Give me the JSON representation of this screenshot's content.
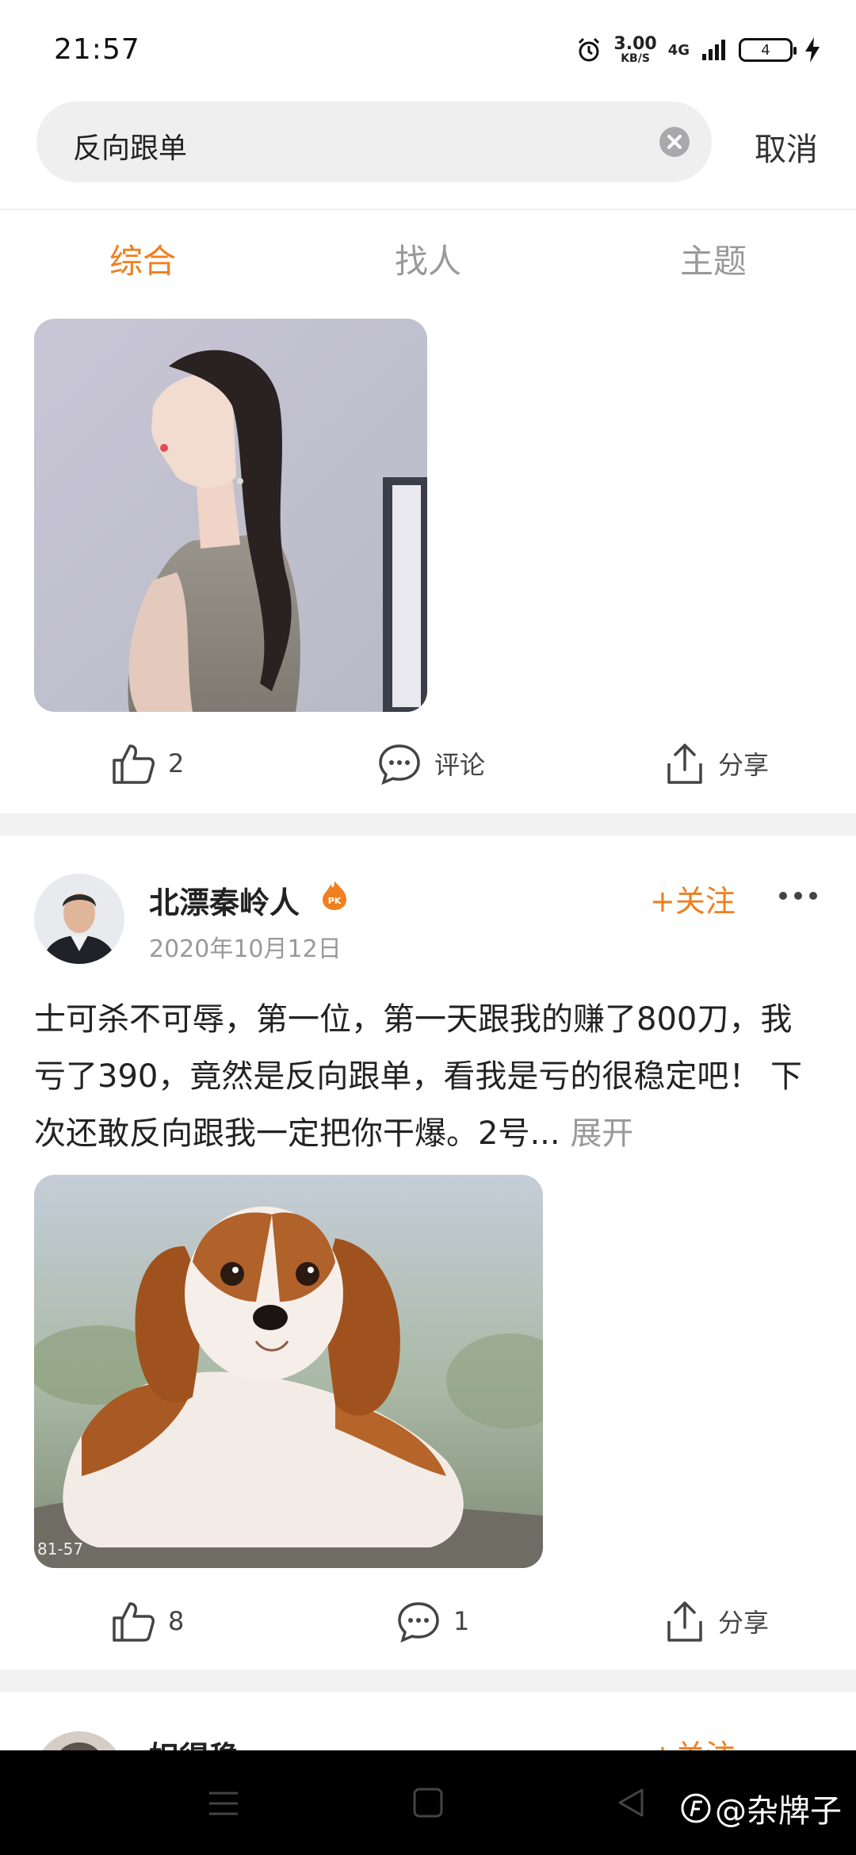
{
  "status_bar": {
    "time": "21:57",
    "speed_value": "3.00",
    "speed_unit": "KB/S",
    "network": "4G",
    "battery": "4"
  },
  "search": {
    "query": "反向跟单",
    "cancel_label": "取消"
  },
  "tabs": [
    {
      "label": "综合",
      "active": true
    },
    {
      "label": "找人",
      "active": false
    },
    {
      "label": "主题",
      "active": false
    }
  ],
  "post1": {
    "likes": "2",
    "comment_label": "评论",
    "share_label": "分享"
  },
  "post2": {
    "author": "北漂秦岭人",
    "date": "2020年10月12日",
    "follow_label": "+关注",
    "text": "士可杀不可辱，第一位，第一天跟我的赚了800刀，我亏了390，竟然是反向跟单，看我是亏的很稳定吧！ 下次还敢反向跟我一定把你干爆。2号...",
    "expand_label": "展开",
    "image_caption": "81-57",
    "likes": "8",
    "comments": "1",
    "share_label": "分享"
  },
  "post3": {
    "author": "妲得稳",
    "follow_label": "+关注"
  },
  "watermark": "@杂牌子",
  "colors": {
    "accent": "#f07f1f",
    "muted": "#999999"
  }
}
